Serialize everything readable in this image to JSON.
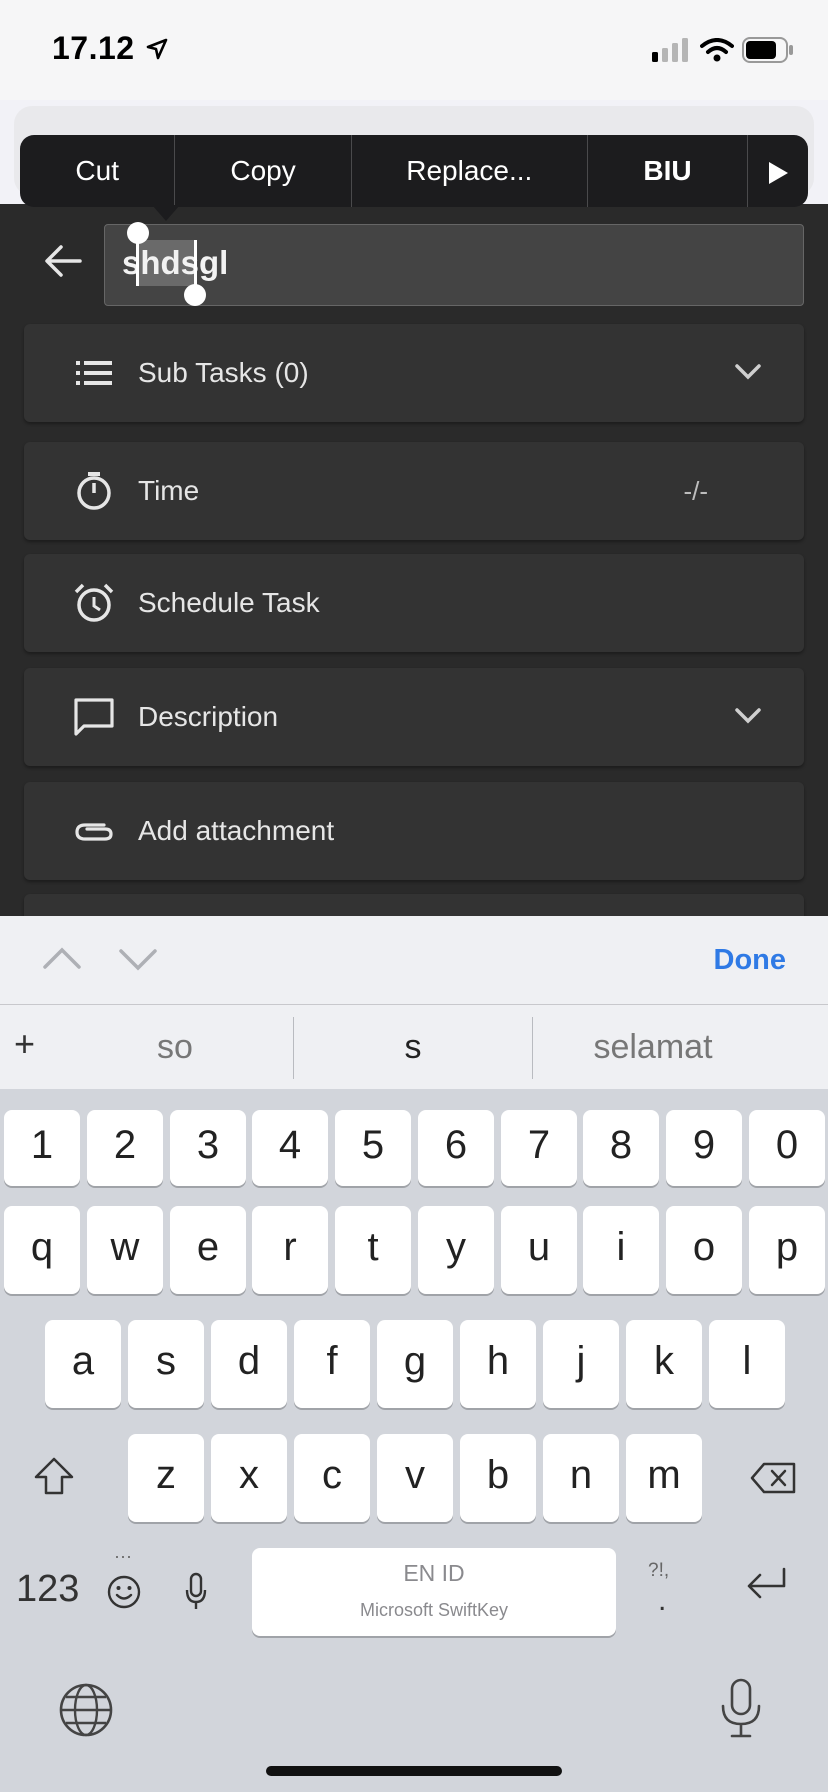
{
  "status_bar": {
    "time": "17.12"
  },
  "context_menu": {
    "items": [
      "Cut",
      "Copy",
      "Replace...",
      "BIU"
    ]
  },
  "task": {
    "title": "shdsgl",
    "cards": [
      {
        "label": "Sub Tasks (0)",
        "icon": "list-icon"
      },
      {
        "label": "Time",
        "icon": "stopwatch-icon",
        "value": "-/-"
      },
      {
        "label": "Schedule Task",
        "icon": "alarm-icon"
      },
      {
        "label": "Description",
        "icon": "comment-icon"
      },
      {
        "label": "Add attachment",
        "icon": "paperclip-icon"
      }
    ]
  },
  "accessory_bar": {
    "done_label": "Done"
  },
  "suggestions": [
    "so",
    "s",
    "selamat"
  ],
  "keyboard": {
    "row_numbers": [
      "1",
      "2",
      "3",
      "4",
      "5",
      "6",
      "7",
      "8",
      "9",
      "0"
    ],
    "row_top": [
      "q",
      "w",
      "e",
      "r",
      "t",
      "y",
      "u",
      "i",
      "o",
      "p"
    ],
    "row_middle": [
      "a",
      "s",
      "d",
      "f",
      "g",
      "h",
      "j",
      "k",
      "l"
    ],
    "row_bottom": [
      "z",
      "x",
      "c",
      "v",
      "b",
      "n",
      "m"
    ],
    "numbers_label": "123",
    "space_language": "EN ID",
    "space_brand": "Microsoft SwiftKey",
    "punct_label": "?!,"
  }
}
